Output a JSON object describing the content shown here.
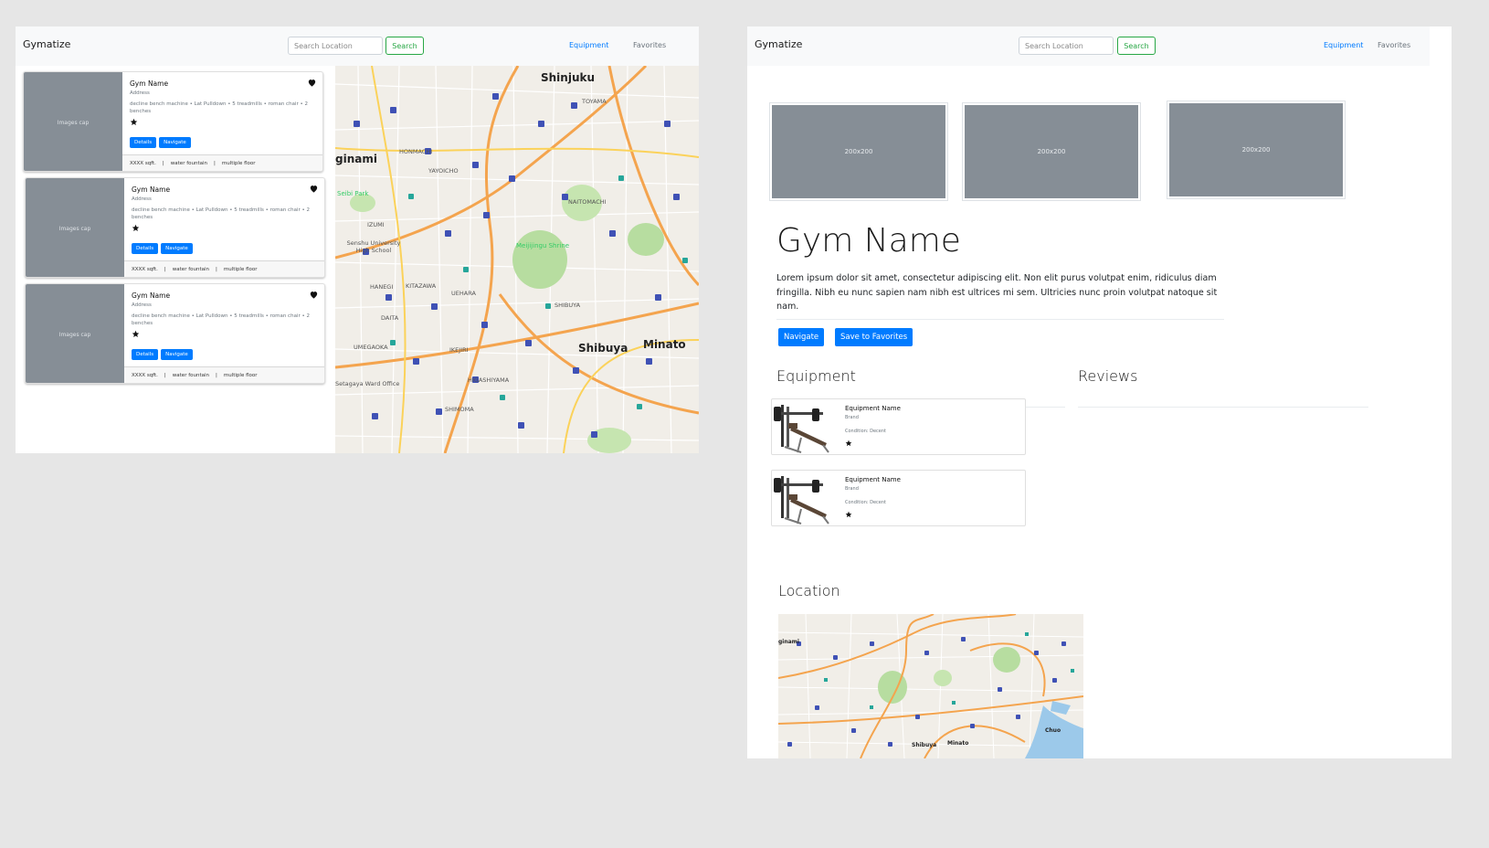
{
  "app": {
    "brand": "Gymatize",
    "search_placeholder": "Search Location",
    "search_label": "Search",
    "nav": [
      {
        "label": "Equipment",
        "active": true
      },
      {
        "label": "Favorites",
        "active": false
      }
    ]
  },
  "list_view": {
    "gyms": [
      {
        "title": "Gym Name",
        "address": "Address",
        "description": "decline bench machine • Lat Pulldown • 5 treadmills • roman chair • 2 benches",
        "image_caption": "Images cap",
        "buttons": [
          "Details",
          "Navigate"
        ],
        "features": [
          "XXXX sqft.",
          "water fountain",
          "multiple floor"
        ],
        "rating_stars": 1
      },
      {
        "title": "Gym Name",
        "address": "Address",
        "description": "decline bench machine • Lat Pulldown • 5 treadmills • roman chair • 2 benches",
        "image_caption": "Images cap",
        "buttons": [
          "Details",
          "Navigate"
        ],
        "features": [
          "XXXX sqft.",
          "water fountain",
          "multiple floor"
        ],
        "rating_stars": 1
      },
      {
        "title": "Gym Name",
        "address": "Address",
        "description": "decline bench machine • Lat Pulldown • 5 treadmills • roman chair • 2 benches",
        "image_caption": "Images cap",
        "buttons": [
          "Details",
          "Navigate"
        ],
        "features": [
          "XXXX sqft.",
          "water fountain",
          "multiple floor"
        ],
        "rating_stars": 1
      }
    ],
    "map_labels": [
      "Shinjuku",
      "ginami",
      "Shibuya",
      "Minato",
      "Meijijingu Shrine",
      "TOYAMA",
      "HONMACHI",
      "YAYOICHO",
      "NAITOMACHI",
      "KITAZAWA",
      "UEHARA",
      "DAITA",
      "SHIBUYA",
      "IKEJIRI",
      "HIGASHIYAMA",
      "SHIMOMA",
      "HANEGI",
      "UMEGAOKA",
      "Seibi Park",
      "Senshu University High School",
      "Setagaya Ward Office",
      "IZUMI"
    ]
  },
  "detail_view": {
    "thumbnails": [
      "200x200",
      "200x200",
      "200x200"
    ],
    "title": "Gym Name",
    "lead": "Lorem ipsum dolor sit amet, consectetur adipiscing elit. Non elit purus volutpat enim, ridiculus diam fringilla. Nibh eu nunc sapien nam nibh est ultrices mi sem. Ultricies nunc proin volutpat natoque sit nam.",
    "buttons": {
      "navigate": "Navigate",
      "favorite": "Save to Favorites"
    },
    "sections": {
      "equipment": "Equipment",
      "reviews": "Reviews",
      "location": "Location"
    },
    "equipment": [
      {
        "name": "Equipment Name",
        "brand": "Brand",
        "condition": "Condition: Decent",
        "rating_stars": 1
      },
      {
        "name": "Equipment Name",
        "brand": "Brand",
        "condition": "Condition: Decent",
        "rating_stars": 1
      }
    ],
    "map_labels": [
      "ginami",
      "Shibuya",
      "Minato",
      "Chuo"
    ]
  },
  "colors": {
    "primary": "#007bff",
    "success": "#28a745",
    "placeholder_gray": "#868e96",
    "navbar_bg": "#f8f9fa",
    "canvas_bg": "#e6e6e6"
  },
  "icons": [
    "heart-icon",
    "star-icon",
    "bench-press-icon",
    "map"
  ]
}
